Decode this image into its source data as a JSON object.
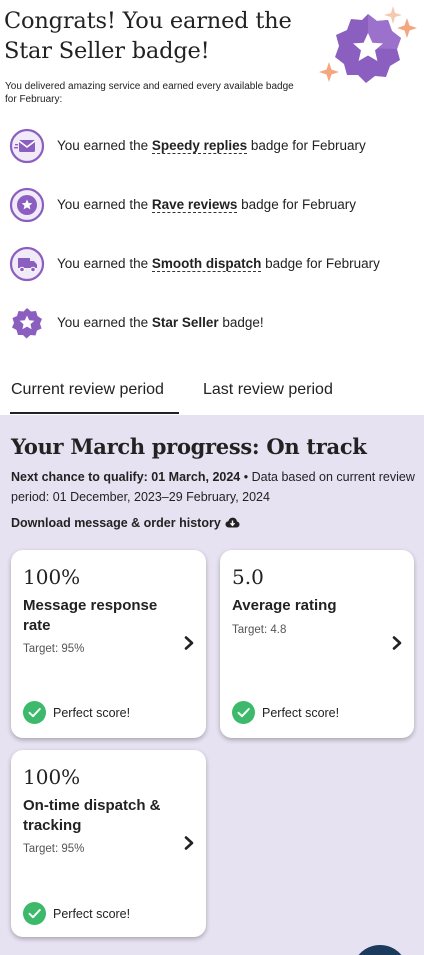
{
  "header": {
    "title": "Congrats! You earned the Star Seller badge!",
    "subtitle": "You delivered amazing service and earned every available badge for February:"
  },
  "badges": [
    {
      "icon": "envelope-icon",
      "prefix": "You earned the ",
      "name": "Speedy replies",
      "suffix": " badge for February"
    },
    {
      "icon": "star-review-icon",
      "prefix": "You earned the ",
      "name": "Rave reviews",
      "suffix": " badge for February"
    },
    {
      "icon": "truck-icon",
      "prefix": "You earned the ",
      "name": "Smooth dispatch",
      "suffix": " badge for February"
    },
    {
      "icon": "star-seller-icon",
      "prefix": "You earned the ",
      "name": "Star Seller",
      "suffix": " badge!"
    }
  ],
  "tabs": [
    {
      "label": "Current review period",
      "active": true
    },
    {
      "label": "Last review period",
      "active": false
    }
  ],
  "progress": {
    "title": "Your March progress: On track",
    "next_chance_label": "Next chance to qualify: 01 March, 2024",
    "separator": " • ",
    "data_note": "Data based on current review period: 01 December, 2023–29 February, 2024",
    "download_label": "Download message & order history",
    "download_icon": "cloud-download-icon"
  },
  "cards": [
    {
      "value": "100%",
      "metric": "Message response rate",
      "target": "Target: 95%",
      "status": "Perfect score!"
    },
    {
      "value": "5.0",
      "metric": "Average rating",
      "target": "Target: 4.8",
      "status": "Perfect score!"
    },
    {
      "value": "100%",
      "metric": "On-time dispatch & tracking",
      "target": "Target: 95%",
      "status": "Perfect score!"
    }
  ],
  "colors": {
    "brand_purple": "#7e57c2",
    "badge_purple": "#8b5fbf",
    "panel_bg": "#e7e2f1",
    "success_green": "#3cb96b",
    "sparkle_orange": "#f4a77e"
  }
}
